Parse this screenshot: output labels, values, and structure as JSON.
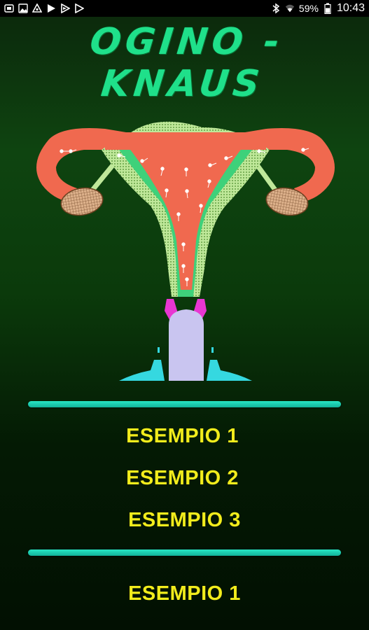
{
  "status_bar": {
    "icons_left": [
      "screenshot-icon",
      "gallery-icon",
      "cloud-sync-icon",
      "play-store-icon",
      "play-store-icon",
      "play-games-icon"
    ],
    "icons_right": [
      "bluetooth-icon",
      "wifi-icon"
    ],
    "battery_percent": "59%",
    "time": "10:43"
  },
  "app": {
    "title": "OGINO - KNAUS",
    "menu_group_1": [
      "ESEMPIO 1",
      "ESEMPIO 2",
      "ESEMPIO 3"
    ],
    "menu_group_2": [
      "ESEMPIO 1"
    ]
  },
  "colors": {
    "title": "#1fe08a",
    "menu_text": "#f2ec1c",
    "divider": "#1ccdb0",
    "background_top": "#0e4410",
    "background_bottom": "#021002",
    "uterus_body": "#f0694f",
    "uterus_wall": "#b9e58a",
    "ovary": "#d9a980",
    "cervix_cap": "#c9c5f0",
    "vaginal_fornix": "#35d8e0",
    "cervix_ring": "#e836d2"
  },
  "illustration": {
    "subject": "uterus-diagram"
  }
}
